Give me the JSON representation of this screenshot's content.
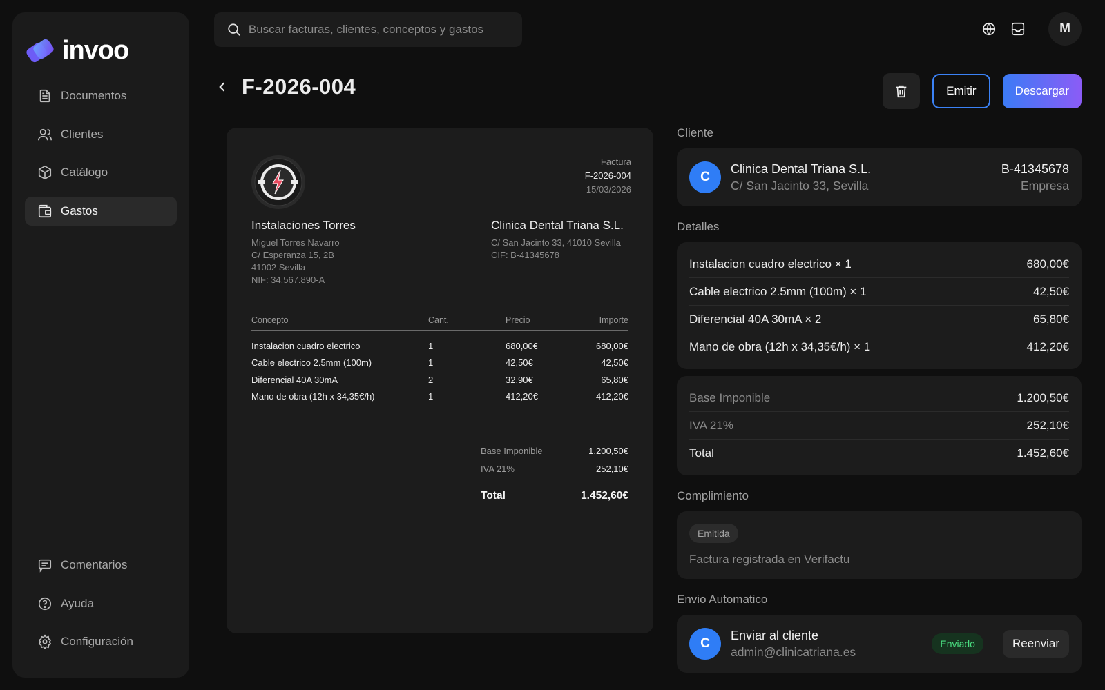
{
  "app": {
    "name": "invoo"
  },
  "sidebar": {
    "items": [
      {
        "label": "Documentos",
        "icon": "document-icon"
      },
      {
        "label": "Clientes",
        "icon": "users-icon"
      },
      {
        "label": "Catálogo",
        "icon": "box-icon"
      },
      {
        "label": "Gastos",
        "icon": "wallet-icon",
        "active": true
      }
    ],
    "bottom_items": [
      {
        "label": "Comentarios",
        "icon": "comment-icon"
      },
      {
        "label": "Ayuda",
        "icon": "help-icon"
      },
      {
        "label": "Configuración",
        "icon": "gear-icon"
      }
    ]
  },
  "search": {
    "placeholder": "Buscar facturas, clientes, conceptos y gastos"
  },
  "header": {
    "avatar_initial": "M"
  },
  "page": {
    "title": "F-2026-004",
    "actions": {
      "emit": "Emitir",
      "download": "Descargar"
    }
  },
  "invoice": {
    "type_label": "Factura",
    "number": "F-2026-004",
    "date": "15/03/2026",
    "from": {
      "name": "Instalaciones Torres",
      "lines": [
        "Miguel Torres Navarro",
        "C/ Esperanza 15, 2B",
        "41002 Sevilla",
        "NIF: 34.567.890-A"
      ]
    },
    "to": {
      "name": "Clinica Dental Triana S.L.",
      "lines": [
        "C/ San Jacinto 33, 41010 Sevilla",
        "CIF: B-41345678"
      ]
    },
    "columns": [
      "Concepto",
      "Cant.",
      "Precio",
      "Importe"
    ],
    "rows": [
      [
        "Instalacion cuadro electrico",
        "1",
        "680,00€",
        "680,00€"
      ],
      [
        "Cable electrico 2.5mm (100m)",
        "1",
        "42,50€",
        "42,50€"
      ],
      [
        "Diferencial 40A 30mA",
        "2",
        "32,90€",
        "65,80€"
      ],
      [
        "Mano de obra (12h x 34,35€/h)",
        "1",
        "412,20€",
        "412,20€"
      ]
    ],
    "totals": {
      "base_label": "Base Imponible",
      "base": "1.200,50€",
      "iva_label": "IVA 21%",
      "iva": "252,10€",
      "total_label": "Total",
      "total": "1.452,60€"
    }
  },
  "right": {
    "client_label": "Cliente",
    "client": {
      "initial": "C",
      "name": "Clinica Dental Triana S.L.",
      "address": "C/ San Jacinto 33, Sevilla",
      "cif": "B-41345678",
      "type": "Empresa"
    },
    "details_label": "Detalles",
    "details": [
      {
        "label": "Instalacion cuadro electrico × 1",
        "value": "680,00€"
      },
      {
        "label": "Cable electrico 2.5mm (100m) × 1",
        "value": "42,50€"
      },
      {
        "label": "Diferencial 40A 30mA × 2",
        "value": "65,80€"
      },
      {
        "label": "Mano de obra (12h x 34,35€/h) × 1",
        "value": "412,20€"
      }
    ],
    "summary": [
      {
        "label": "Base Imponible",
        "value": "1.200,50€"
      },
      {
        "label": "IVA 21%",
        "value": "252,10€"
      },
      {
        "label": "Total",
        "value": "1.452,60€"
      }
    ],
    "compliance_label": "Complimiento",
    "compliance": {
      "status": "Emitida",
      "text": "Factura registrada en Verifactu"
    },
    "auto_send_label": "Envio Automatico",
    "auto_send": {
      "initial": "C",
      "title": "Enviar al cliente",
      "email": "admin@clinicatriana.es",
      "status": "Enviado",
      "resend": "Reenviar"
    }
  },
  "colors": {
    "accent": "#3b82f6",
    "accent_gradient_end": "#8b5cf6",
    "success": "#4ade80",
    "background": "#0f0f0f",
    "card": "#1c1c1c"
  }
}
